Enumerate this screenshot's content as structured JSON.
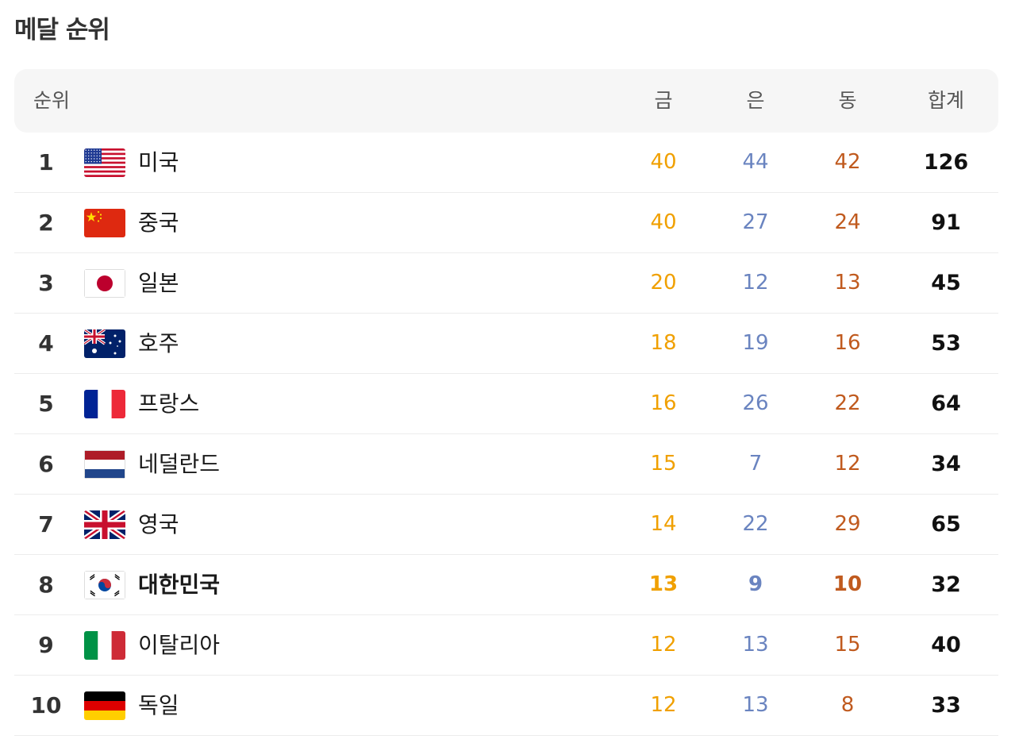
{
  "title": "메달 순위",
  "headers": {
    "rank": "순위",
    "gold": "금",
    "silver": "은",
    "bronze": "동",
    "total": "합계"
  },
  "colors": {
    "gold": "#f0a000",
    "silver": "#6a84c0",
    "bronze": "#c05a1e"
  },
  "rows": [
    {
      "rank": "1",
      "country": "미국",
      "flag": "us-flag-icon",
      "gold": "40",
      "silver": "44",
      "bronze": "42",
      "total": "126"
    },
    {
      "rank": "2",
      "country": "중국",
      "flag": "cn-flag-icon",
      "gold": "40",
      "silver": "27",
      "bronze": "24",
      "total": "91"
    },
    {
      "rank": "3",
      "country": "일본",
      "flag": "jp-flag-icon",
      "gold": "20",
      "silver": "12",
      "bronze": "13",
      "total": "45"
    },
    {
      "rank": "4",
      "country": "호주",
      "flag": "au-flag-icon",
      "gold": "18",
      "silver": "19",
      "bronze": "16",
      "total": "53"
    },
    {
      "rank": "5",
      "country": "프랑스",
      "flag": "fr-flag-icon",
      "gold": "16",
      "silver": "26",
      "bronze": "22",
      "total": "64"
    },
    {
      "rank": "6",
      "country": "네덜란드",
      "flag": "nl-flag-icon",
      "gold": "15",
      "silver": "7",
      "bronze": "12",
      "total": "34"
    },
    {
      "rank": "7",
      "country": "영국",
      "flag": "gb-flag-icon",
      "gold": "14",
      "silver": "22",
      "bronze": "29",
      "total": "65"
    },
    {
      "rank": "8",
      "country": "대한민국",
      "flag": "kr-flag-icon",
      "gold": "13",
      "silver": "9",
      "bronze": "10",
      "total": "32",
      "highlight": true
    },
    {
      "rank": "9",
      "country": "이탈리아",
      "flag": "it-flag-icon",
      "gold": "12",
      "silver": "13",
      "bronze": "15",
      "total": "40"
    },
    {
      "rank": "10",
      "country": "독일",
      "flag": "de-flag-icon",
      "gold": "12",
      "silver": "13",
      "bronze": "8",
      "total": "33"
    }
  ]
}
